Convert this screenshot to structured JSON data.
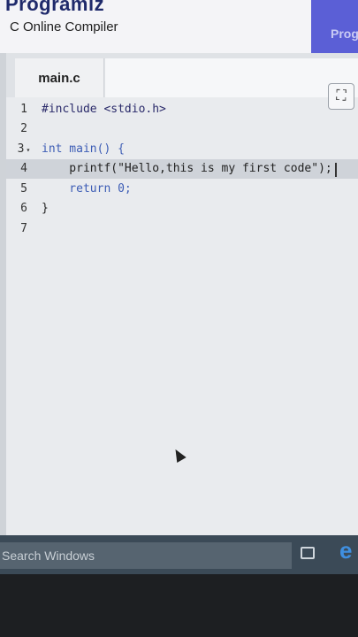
{
  "header": {
    "brand": "Programiz",
    "subtitle": "C Online Compiler",
    "ad_brand": "Prog"
  },
  "editor": {
    "tab_label": "main.c",
    "fullscreen_icon": "fullscreen-icon",
    "active_line": 4,
    "lines": [
      {
        "number": "1",
        "code": "#include <stdio.h>"
      },
      {
        "number": "2",
        "code": ""
      },
      {
        "number": "3",
        "code": "int main() {"
      },
      {
        "number": "4",
        "code": "    printf(\"Hello,this is my first code\");"
      },
      {
        "number": "5",
        "code": "    return 0;"
      },
      {
        "number": "6",
        "code": "}"
      },
      {
        "number": "7",
        "code": ""
      }
    ]
  },
  "taskbar": {
    "search_placeholder": "Search Windows",
    "taskview_icon": "task-view-icon",
    "browser_icon": "edge-browser-icon",
    "browser_glyph": "e"
  },
  "colors": {
    "brand": "#1f2a6b",
    "keyword": "#3d5db5",
    "taskbar": "#3b4a57"
  }
}
